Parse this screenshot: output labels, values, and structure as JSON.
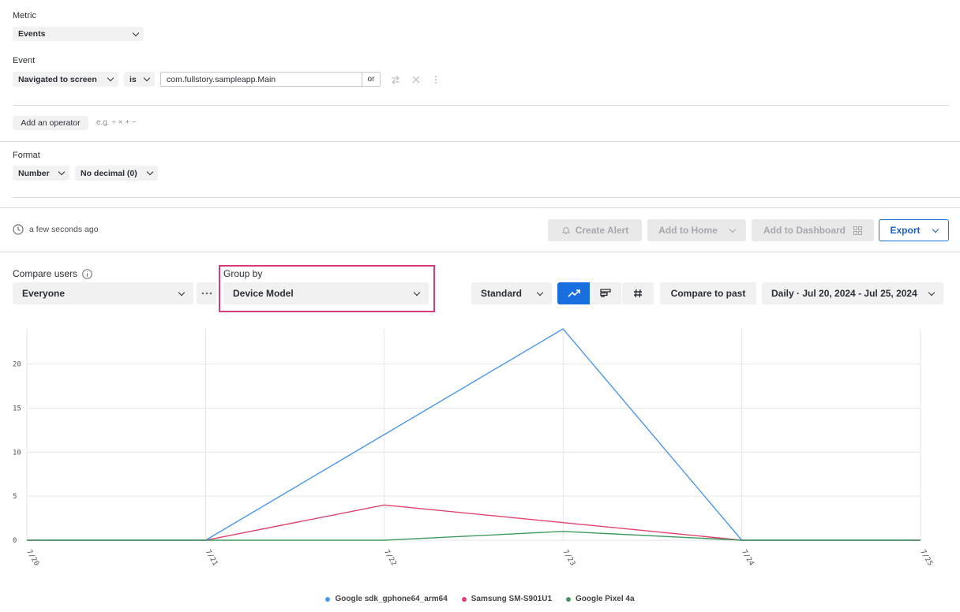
{
  "metric": {
    "label": "Metric",
    "value": "Events"
  },
  "event": {
    "label": "Event",
    "type": "Navigated to screen",
    "operator": "is",
    "value": "com.fullstory.sampleapp.Main",
    "or_label": "or"
  },
  "operator": {
    "button": "Add an operator",
    "hint": "e.g. ÷ × + −"
  },
  "format": {
    "label": "Format",
    "type": "Number",
    "decimals": "No decimal (0)"
  },
  "toolbar": {
    "updated": "a few seconds ago",
    "create_alert": "Create Alert",
    "add_home": "Add to Home",
    "add_dashboard": "Add to Dashboard",
    "export": "Export"
  },
  "controls": {
    "compare_label": "Compare users",
    "compare_value": "Everyone",
    "group_label": "Group by",
    "group_value": "Device Model",
    "mode": "Standard",
    "compare_past": "Compare to past",
    "date_range": "Daily · Jul 20, 2024 - Jul 25, 2024"
  },
  "colors": {
    "accent": "#1a6fe0",
    "highlight": "#d63a78"
  },
  "chart_data": {
    "type": "line",
    "categories": [
      "7/20",
      "7/21",
      "7/22",
      "7/23",
      "7/24",
      "7/25"
    ],
    "ylim": [
      0,
      24
    ],
    "yticks": [
      "0",
      "5",
      "10",
      "15",
      "20"
    ],
    "grid": true,
    "legend": "bottom",
    "series": [
      {
        "name": "Google sdk_gphone64_arm64",
        "color": "#4a97ee",
        "values": [
          0,
          0,
          12,
          24,
          0,
          0
        ]
      },
      {
        "name": "Samsung SM-S901U1",
        "color": "#e0426e",
        "values": [
          0,
          0,
          4,
          2,
          0,
          0
        ]
      },
      {
        "name": "Google Pixel 4a",
        "color": "#3c9a5f",
        "values": [
          0,
          0,
          0,
          1,
          0,
          0
        ]
      }
    ]
  }
}
